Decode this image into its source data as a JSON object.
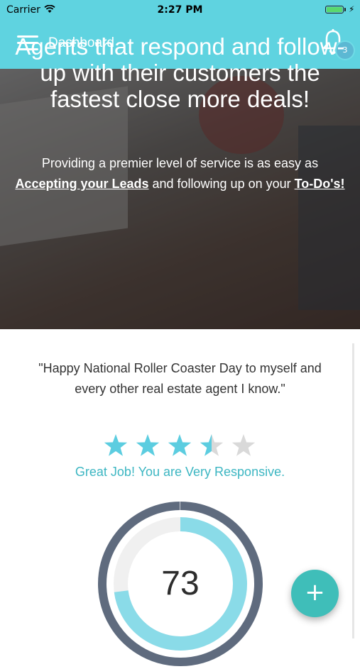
{
  "status_bar": {
    "carrier": "Carrier",
    "time": "2:27 PM"
  },
  "nav": {
    "title": "Dashboard",
    "notification_count": "3"
  },
  "hero": {
    "headline": "Agents that respond and follow-up with their customers the fastest close more deals!",
    "body_prefix": "Providing a premier level of service is as easy as ",
    "link_leads": "Accepting your Leads",
    "body_middle": " and following up on your ",
    "link_todos": "To-Do's!"
  },
  "quote": "\"Happy National Roller Coaster Day to myself and every other real estate agent I know.\"",
  "rating": {
    "stars": 3.5,
    "max": 5,
    "text": "Great Job! You are Very Responsive."
  },
  "score": {
    "value": "73",
    "fraction": 0.73
  },
  "colors": {
    "accent": "#5fd3e0",
    "star": "#5ccde0",
    "star_empty": "#d9d9d9",
    "fab": "#3fbeb9",
    "gauge_outer": "#5f6b7e",
    "gauge_inner": "#8adbe8"
  },
  "fab": {
    "icon": "plus-icon"
  }
}
